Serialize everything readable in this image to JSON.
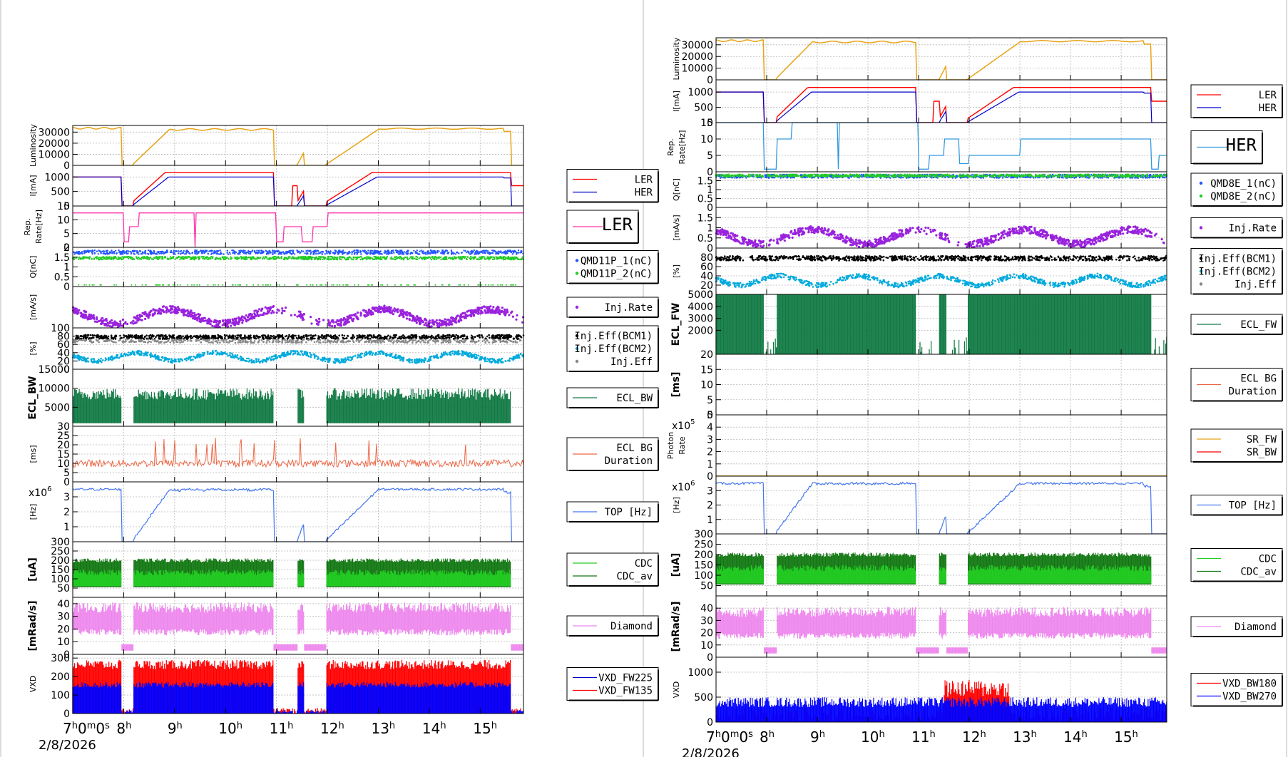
{
  "chart_data": [
    {
      "type": "line",
      "x_ticks": [
        "7h0m0s",
        "8h",
        "9h",
        "10h",
        "11h",
        "12h",
        "13h",
        "14h",
        "15h"
      ],
      "x_range_hours": [
        7,
        15.85
      ],
      "date_label": "2/8/2026",
      "panels": [
        {
          "ylabel": [
            "Luminosity"
          ],
          "ylim": [
            0,
            36000
          ],
          "yticks": [
            0,
            10000,
            20000,
            30000
          ],
          "kind": "lumi",
          "legend": null,
          "series": [
            {
              "name": "",
              "color": "#e8a317"
            }
          ]
        },
        {
          "ylabel": [
            "I[mA]"
          ],
          "ylim": [
            0,
            1400
          ],
          "yticks": [
            0,
            500,
            1000
          ],
          "kind": "current",
          "legend": {
            "entries": [
              {
                "label": "LER",
                "color": "#ff0000",
                "marker": "line"
              },
              {
                "label": "HER",
                "color": "#0000cc",
                "marker": "line"
              }
            ],
            "size": "small"
          },
          "series": [
            {
              "name": "LER",
              "color": "#ff0000"
            },
            {
              "name": "HER",
              "color": "#0000cc"
            }
          ]
        },
        {
          "ylabel": [
            "Rep.",
            "Rate[Hz]"
          ],
          "ylim": [
            0,
            15
          ],
          "yticks": [
            0,
            5,
            10,
            15
          ],
          "kind": "rep",
          "legend": {
            "entries": [
              {
                "label": "LER",
                "color": "#ff33aa",
                "marker": "line"
              }
            ],
            "size": "large"
          },
          "series": [
            {
              "name": "LER",
              "color": "#ff33aa"
            }
          ]
        },
        {
          "ylabel": [
            "Q[nC]"
          ],
          "ylim": [
            0,
            2
          ],
          "yticks": [
            0,
            0.5,
            1,
            1.5,
            2
          ],
          "kind": "charge",
          "legend": {
            "entries": [
              {
                "label": "QMD11P_1(nC)",
                "color": "#2255ff",
                "marker": "dot"
              },
              {
                "label": "QMD11P_2(nC)",
                "color": "#22cc22",
                "marker": "dot"
              }
            ],
            "size": "small"
          },
          "series": [
            {
              "name": "QMD11P_1(nC)",
              "color": "#2255ff"
            },
            {
              "name": "QMD11P_2(nC)",
              "color": "#22cc22"
            }
          ]
        },
        {
          "ylabel": [
            "[mA/s]"
          ],
          "ylim": [
            0,
            2
          ],
          "yticks": [],
          "kind": "injrate",
          "legend": {
            "entries": [
              {
                "label": "Inj.Rate",
                "color": "#9922dd",
                "marker": "dot"
              }
            ],
            "size": "small"
          },
          "series": [
            {
              "name": "Inj.Rate",
              "color": "#9922dd"
            }
          ]
        },
        {
          "ylabel": [
            "[%]"
          ],
          "ylim": [
            0,
            100
          ],
          "yticks": [
            0,
            20,
            40,
            60,
            80,
            100
          ],
          "kind": "eff",
          "legend": {
            "entries": [
              {
                "label": "Inj.Eff(BCM1)",
                "color": "#000000",
                "marker": "dot"
              },
              {
                "label": "Inj.Eff(BCM2)",
                "color": "#00aadd",
                "marker": "dot"
              },
              {
                "label": "Inj.Eff",
                "color": "#888888",
                "marker": "dot"
              }
            ],
            "size": "small"
          },
          "series": [
            {
              "name": "Inj.Eff(BCM1)",
              "color": "#000000"
            },
            {
              "name": "Inj.Eff(BCM2)",
              "color": "#00aadd"
            },
            {
              "name": "Inj.Eff",
              "color": "#888888"
            }
          ]
        },
        {
          "ylabel": [
            "ECL_BW"
          ],
          "ylim": [
            0,
            15000
          ],
          "yticks": [
            5000,
            10000,
            15000
          ],
          "kind": "eclbw",
          "bold_label": true,
          "legend": {
            "entries": [
              {
                "label": "ECL_BW",
                "color": "#117a44",
                "marker": "line"
              }
            ],
            "size": "small"
          },
          "series": [
            {
              "name": "ECL_BW",
              "color": "#117a44"
            }
          ]
        },
        {
          "ylabel": [
            "[ms]"
          ],
          "ylim": [
            0,
            30
          ],
          "yticks": [
            0,
            5,
            10,
            15,
            20,
            25,
            30
          ],
          "kind": "eclbg",
          "legend": {
            "entries": [
              {
                "label": "ECL BG\nDuration",
                "color": "#ee6644",
                "marker": "line"
              }
            ],
            "size": "small"
          },
          "series": [
            {
              "name": "ECL BG Duration",
              "color": "#ee6644"
            }
          ]
        },
        {
          "ylabel": [
            "[Hz]"
          ],
          "ylim": [
            0,
            4
          ],
          "yticks": [
            1,
            2,
            3
          ],
          "kind": "top",
          "multiplier": "x10^6",
          "legend": {
            "entries": [
              {
                "label": "TOP [Hz]",
                "color": "#4477ee",
                "marker": "line"
              }
            ],
            "size": "small"
          },
          "series": [
            {
              "name": "TOP [Hz]",
              "color": "#4477ee"
            }
          ]
        },
        {
          "ylabel": [
            "[uA]"
          ],
          "ylim": [
            0,
            300
          ],
          "yticks": [
            50,
            100,
            150,
            200,
            250,
            300
          ],
          "kind": "cdc",
          "bold_label": true,
          "legend": {
            "entries": [
              {
                "label": "CDC",
                "color": "#22cc22",
                "marker": "line"
              },
              {
                "label": "CDC_av",
                "color": "#117711",
                "marker": "line"
              }
            ],
            "size": "small"
          },
          "series": [
            {
              "name": "CDC",
              "color": "#22cc22"
            },
            {
              "name": "CDC_av",
              "color": "#117711"
            }
          ]
        },
        {
          "ylabel": [
            "[mRad/s]"
          ],
          "ylim": [
            0,
            45
          ],
          "yticks": [
            0,
            10,
            20,
            30,
            40
          ],
          "kind": "diamond",
          "bold_label": true,
          "legend": {
            "entries": [
              {
                "label": "Diamond",
                "color": "#ee88ee",
                "marker": "line"
              }
            ],
            "size": "small"
          },
          "series": [
            {
              "name": "Diamond",
              "color": "#ee88ee"
            }
          ]
        },
        {
          "ylabel": [
            "VXD"
          ],
          "ylim": [
            0,
            320
          ],
          "yticks": [
            0,
            100,
            200,
            300
          ],
          "kind": "vxdL",
          "legend": {
            "entries": [
              {
                "label": "VXD_FW225",
                "color": "#0000cc",
                "marker": "line"
              },
              {
                "label": "VXD_FW135",
                "color": "#ff0000",
                "marker": "line"
              }
            ],
            "size": "small"
          },
          "series": [
            {
              "name": "VXD_FW225",
              "color": "#0000ff"
            },
            {
              "name": "VXD_FW135",
              "color": "#ff0000"
            }
          ]
        }
      ]
    },
    {
      "type": "line",
      "x_ticks": [
        "7h0m0s",
        "8h",
        "9h",
        "10h",
        "11h",
        "12h",
        "13h",
        "14h",
        "15h"
      ],
      "x_range_hours": [
        7,
        15.9
      ],
      "date_label": "2/8/2026",
      "panels": [
        {
          "ylabel": [
            "Luminosity"
          ],
          "ylim": [
            0,
            36000
          ],
          "yticks": [
            0,
            10000,
            20000,
            30000
          ],
          "kind": "lumi",
          "legend": null,
          "series": [
            {
              "name": "",
              "color": "#e8a317"
            }
          ]
        },
        {
          "ylabel": [
            "I[mA]"
          ],
          "ylim": [
            0,
            1400
          ],
          "yticks": [
            0,
            500,
            1000
          ],
          "kind": "current",
          "legend": {
            "entries": [
              {
                "label": "LER",
                "color": "#ff0000",
                "marker": "line"
              },
              {
                "label": "HER",
                "color": "#0000cc",
                "marker": "line"
              }
            ],
            "size": "small"
          },
          "series": [
            {
              "name": "LER",
              "color": "#ff0000"
            },
            {
              "name": "HER",
              "color": "#0000cc"
            }
          ]
        },
        {
          "ylabel": [
            "Rep.",
            "Rate[Hz]"
          ],
          "ylim": [
            0,
            15
          ],
          "yticks": [
            0,
            5,
            10,
            15
          ],
          "kind": "repHER",
          "legend": {
            "entries": [
              {
                "label": "HER",
                "color": "#3399dd",
                "marker": "line"
              }
            ],
            "size": "large"
          },
          "series": [
            {
              "name": "HER",
              "color": "#3399dd"
            }
          ]
        },
        {
          "ylabel": [
            "Q[nC]"
          ],
          "ylim": [
            0,
            2
          ],
          "yticks": [
            0,
            0.5,
            1,
            1.5
          ],
          "kind": "chargeHER",
          "legend": {
            "entries": [
              {
                "label": "QMD8E_1(nC)",
                "color": "#2255ff",
                "marker": "dot"
              },
              {
                "label": "QMD8E_2(nC)",
                "color": "#22cc22",
                "marker": "dot"
              }
            ],
            "size": "small"
          },
          "series": [
            {
              "name": "QMD8E_1(nC)",
              "color": "#2255ff"
            },
            {
              "name": "QMD8E_2(nC)",
              "color": "#22cc22"
            }
          ]
        },
        {
          "ylabel": [
            "[mA/s]"
          ],
          "ylim": [
            0,
            2
          ],
          "yticks": [
            0,
            0.5,
            1,
            1.5
          ],
          "kind": "injrateHER",
          "legend": {
            "entries": [
              {
                "label": "Inj.Rate",
                "color": "#9922dd",
                "marker": "dot"
              }
            ],
            "size": "small"
          },
          "series": [
            {
              "name": "Inj.Rate",
              "color": "#9922dd"
            }
          ]
        },
        {
          "ylabel": [
            "[%]"
          ],
          "ylim": [
            0,
            100
          ],
          "yticks": [
            0,
            20,
            40,
            60,
            80
          ],
          "kind": "effHER",
          "legend": {
            "entries": [
              {
                "label": "Inj.Eff(BCM1)",
                "color": "#000000",
                "marker": "dot"
              },
              {
                "label": "Inj.Eff(BCM2)",
                "color": "#00aadd",
                "marker": "dot"
              },
              {
                "label": "Inj.Eff",
                "color": "#888888",
                "marker": "dot"
              }
            ],
            "size": "small"
          },
          "series": [
            {
              "name": "Inj.Eff(BCM1)",
              "color": "#000000"
            },
            {
              "name": "Inj.Eff(BCM2)",
              "color": "#00aadd"
            },
            {
              "name": "Inj.Eff",
              "color": "#888888"
            }
          ]
        },
        {
          "ylabel": [
            "ECL_FW"
          ],
          "ylim": [
            0,
            5000
          ],
          "yticks": [
            2000,
            3000,
            4000,
            5000
          ],
          "kind": "eclfw",
          "bold_label": true,
          "legend": {
            "entries": [
              {
                "label": "ECL_FW",
                "color": "#117a44",
                "marker": "line"
              }
            ],
            "size": "small"
          },
          "series": [
            {
              "name": "ECL_FW",
              "color": "#117a44"
            }
          ]
        },
        {
          "ylabel": [
            "[ms]"
          ],
          "ylim": [
            0,
            20
          ],
          "yticks": [
            0,
            5,
            10,
            15,
            20
          ],
          "kind": "empty",
          "bold_label": true,
          "legend": {
            "entries": [
              {
                "label": "ECL BG\nDuration",
                "color": "#ee6644",
                "marker": "line"
              }
            ],
            "size": "small"
          },
          "series": [
            {
              "name": "ECL BG Duration",
              "color": "#ee6644"
            }
          ]
        },
        {
          "ylabel": [
            "Photon",
            "Rate"
          ],
          "ylim": [
            0,
            5
          ],
          "yticks": [
            0,
            1,
            2,
            3,
            4,
            5
          ],
          "kind": "photon",
          "multiplier": "x10^5",
          "legend": {
            "entries": [
              {
                "label": "SR_FW",
                "color": "#e8a317",
                "marker": "line"
              },
              {
                "label": "SR_BW",
                "color": "#ff0000",
                "marker": "line"
              }
            ],
            "size": "small"
          },
          "series": [
            {
              "name": "SR_FW",
              "color": "#e8a317"
            },
            {
              "name": "SR_BW",
              "color": "#ff0000"
            }
          ]
        },
        {
          "ylabel": [
            "[Hz]"
          ],
          "ylim": [
            0,
            4
          ],
          "yticks": [
            1,
            2,
            3
          ],
          "kind": "top",
          "multiplier": "x10^6",
          "legend": {
            "entries": [
              {
                "label": "TOP [Hz]",
                "color": "#4477ee",
                "marker": "line"
              }
            ],
            "size": "small"
          },
          "series": [
            {
              "name": "TOP [Hz]",
              "color": "#4477ee"
            }
          ]
        },
        {
          "ylabel": [
            "[uA]"
          ],
          "ylim": [
            0,
            300
          ],
          "yticks": [
            50,
            100,
            150,
            200,
            250,
            300
          ],
          "kind": "cdc",
          "bold_label": true,
          "legend": {
            "entries": [
              {
                "label": "CDC",
                "color": "#22cc22",
                "marker": "line"
              },
              {
                "label": "CDC_av",
                "color": "#117711",
                "marker": "line"
              }
            ],
            "size": "small"
          },
          "series": [
            {
              "name": "CDC",
              "color": "#22cc22"
            },
            {
              "name": "CDC_av",
              "color": "#117711"
            }
          ]
        },
        {
          "ylabel": [
            "[mRad/s]"
          ],
          "ylim": [
            0,
            50
          ],
          "yticks": [
            0,
            10,
            20,
            30,
            40
          ],
          "kind": "diamond",
          "bold_label": true,
          "legend": {
            "entries": [
              {
                "label": "Diamond",
                "color": "#ee88ee",
                "marker": "line"
              }
            ],
            "size": "small"
          },
          "series": [
            {
              "name": "Diamond",
              "color": "#ee88ee"
            }
          ]
        },
        {
          "ylabel": [
            "VXD"
          ],
          "ylim": [
            0,
            1300
          ],
          "yticks": [
            0,
            500,
            1000
          ],
          "kind": "vxdR",
          "legend": {
            "entries": [
              {
                "label": "VXD_BW180",
                "color": "#ff0000",
                "marker": "line"
              },
              {
                "label": "VXD_BW270",
                "color": "#0000ff",
                "marker": "line"
              }
            ],
            "size": "small"
          },
          "series": [
            {
              "name": "VXD_BW180",
              "color": "#ff0000"
            },
            {
              "name": "VXD_BW270",
              "color": "#0000ff"
            }
          ]
        }
      ]
    }
  ]
}
